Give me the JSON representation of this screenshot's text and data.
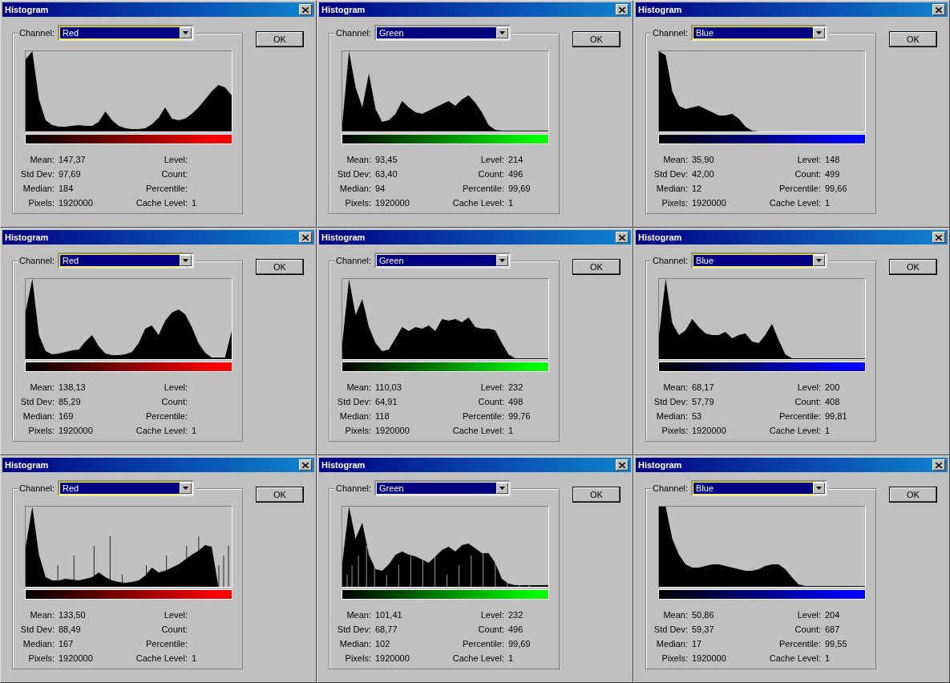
{
  "dialogs": [
    {
      "title": "Histogram",
      "channel_label": "Channel:",
      "channel": "Red",
      "color": "#ff0000",
      "ok": "OK",
      "left": [
        {
          "label": "Mean:",
          "value": "147,37"
        },
        {
          "label": "Std Dev:",
          "value": "97,69"
        },
        {
          "label": "Median:",
          "value": "184"
        },
        {
          "label": "Pixels:",
          "value": "1920000"
        }
      ],
      "right": [
        {
          "label": "Level:"
        },
        {
          "label": "Count:"
        },
        {
          "label": "Percentile:"
        },
        {
          "label": "Cache Level:",
          "value": "1"
        }
      ]
    },
    {
      "title": "Histogram",
      "channel_label": "Channel:",
      "channel": "Green",
      "color": "#00ff00",
      "ok": "OK",
      "left": [
        {
          "label": "Mean:",
          "value": "93,45"
        },
        {
          "label": "Std Dev:",
          "value": "63,40"
        },
        {
          "label": "Median:",
          "value": "94"
        },
        {
          "label": "Pixels:",
          "value": "1920000"
        }
      ],
      "right": [
        {
          "label": "Level:",
          "value": "214"
        },
        {
          "label": "Count:",
          "value": "496"
        },
        {
          "label": "Percentile:",
          "value": "99,69"
        },
        {
          "label": "Cache Level:",
          "value": "1"
        }
      ]
    },
    {
      "title": "Histogram",
      "channel_label": "Channel:",
      "channel": "Blue",
      "color": "#0000ff",
      "ok": "OK",
      "left": [
        {
          "label": "Mean:",
          "value": "35,90"
        },
        {
          "label": "Std Dev:",
          "value": "42,00"
        },
        {
          "label": "Median:",
          "value": "12"
        },
        {
          "label": "Pixels:",
          "value": "1920000"
        }
      ],
      "right": [
        {
          "label": "Level:",
          "value": "148"
        },
        {
          "label": "Count:",
          "value": "499"
        },
        {
          "label": "Percentile:",
          "value": "99,66"
        },
        {
          "label": "Cache Level:",
          "value": "1"
        }
      ]
    },
    {
      "title": "Histogram",
      "channel_label": "Channel:",
      "channel": "Red",
      "color": "#ff0000",
      "ok": "OK",
      "left": [
        {
          "label": "Mean:",
          "value": "138,13"
        },
        {
          "label": "Std Dev:",
          "value": "85,29"
        },
        {
          "label": "Median:",
          "value": "169"
        },
        {
          "label": "Pixels:",
          "value": "1920000"
        }
      ],
      "right": [
        {
          "label": "Level:"
        },
        {
          "label": "Count:"
        },
        {
          "label": "Percentile:"
        },
        {
          "label": "Cache Level:",
          "value": "1"
        }
      ]
    },
    {
      "title": "Histogram",
      "channel_label": "Channel:",
      "channel": "Green",
      "color": "#00ff00",
      "ok": "OK",
      "left": [
        {
          "label": "Mean:",
          "value": "110,03"
        },
        {
          "label": "Std Dev:",
          "value": "64,91"
        },
        {
          "label": "Median:",
          "value": "118"
        },
        {
          "label": "Pixels:",
          "value": "1920000"
        }
      ],
      "right": [
        {
          "label": "Level:",
          "value": "232"
        },
        {
          "label": "Count:",
          "value": "498"
        },
        {
          "label": "Percentile:",
          "value": "99,76"
        },
        {
          "label": "Cache Level:",
          "value": "1"
        }
      ]
    },
    {
      "title": "Histogram",
      "channel_label": "Channel:",
      "channel": "Blue",
      "color": "#0000ff",
      "ok": "OK",
      "left": [
        {
          "label": "Mean:",
          "value": "68,17"
        },
        {
          "label": "Std Dev:",
          "value": "57,79"
        },
        {
          "label": "Median:",
          "value": "53"
        },
        {
          "label": "Pixels:",
          "value": "1920000"
        }
      ],
      "right": [
        {
          "label": "Level:",
          "value": "200"
        },
        {
          "label": "Count:",
          "value": "408"
        },
        {
          "label": "Percentile:",
          "value": "99,81"
        },
        {
          "label": "Cache Level:",
          "value": "1"
        }
      ]
    },
    {
      "title": "Histogram",
      "channel_label": "Channel:",
      "channel": "Red",
      "color": "#ff0000",
      "ok": "OK",
      "left": [
        {
          "label": "Mean:",
          "value": "133,50"
        },
        {
          "label": "Std Dev:",
          "value": "88,49"
        },
        {
          "label": "Median:",
          "value": "167"
        },
        {
          "label": "Pixels:",
          "value": "1920000"
        }
      ],
      "right": [
        {
          "label": "Level:"
        },
        {
          "label": "Count:"
        },
        {
          "label": "Percentile:"
        },
        {
          "label": "Cache Level:",
          "value": "1"
        }
      ]
    },
    {
      "title": "Histogram",
      "channel_label": "Channel:",
      "channel": "Green",
      "color": "#00ff00",
      "ok": "OK",
      "left": [
        {
          "label": "Mean:",
          "value": "101,41"
        },
        {
          "label": "Std Dev:",
          "value": "68,77"
        },
        {
          "label": "Median:",
          "value": "102"
        },
        {
          "label": "Pixels:",
          "value": "1920000"
        }
      ],
      "right": [
        {
          "label": "Level:",
          "value": "232"
        },
        {
          "label": "Count:",
          "value": "496"
        },
        {
          "label": "Percentile:",
          "value": "99,69"
        },
        {
          "label": "Cache Level:",
          "value": "1"
        }
      ]
    },
    {
      "title": "Histogram",
      "channel_label": "Channel:",
      "channel": "Blue",
      "color": "#0000ff",
      "ok": "OK",
      "left": [
        {
          "label": "Mean:",
          "value": "50,86"
        },
        {
          "label": "Std Dev:",
          "value": "59,37"
        },
        {
          "label": "Median:",
          "value": "17"
        },
        {
          "label": "Pixels:",
          "value": "1920000"
        }
      ],
      "right": [
        {
          "label": "Level:",
          "value": "204"
        },
        {
          "label": "Count:",
          "value": "687"
        },
        {
          "label": "Percentile:",
          "value": "99,55"
        },
        {
          "label": "Cache Level:",
          "value": "1"
        }
      ]
    }
  ]
}
